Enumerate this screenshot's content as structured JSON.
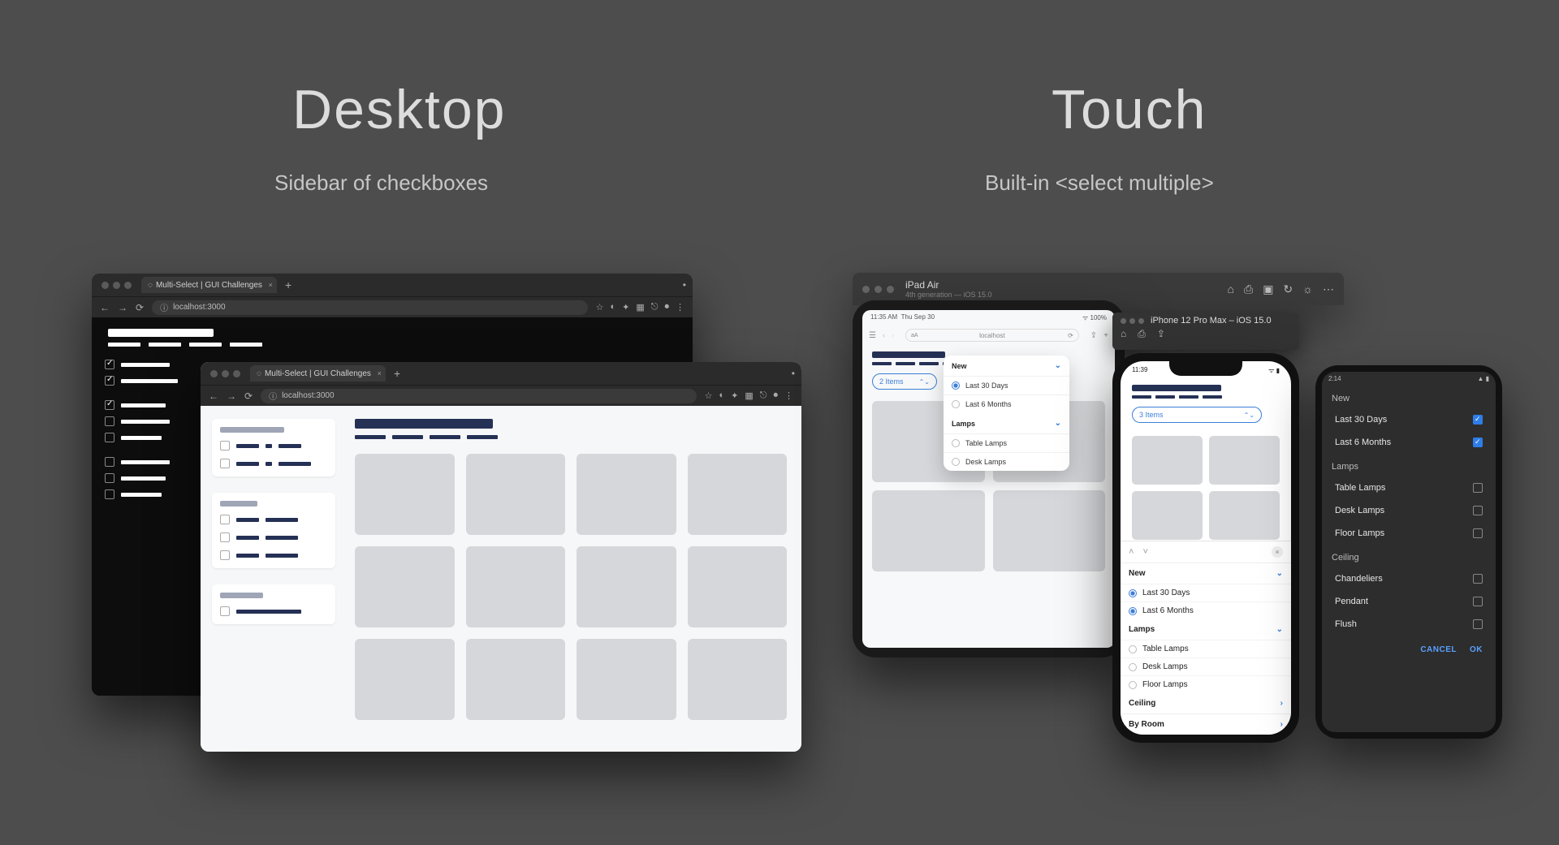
{
  "desktop": {
    "title": "Desktop",
    "subtitle": "Sidebar of checkboxes"
  },
  "touch": {
    "title": "Touch",
    "subtitle": "Built-in <select multiple>"
  },
  "browser": {
    "tab_title": "Multi-Select | GUI Challenges",
    "address": "localhost:3000"
  },
  "ipad_sim": {
    "device": "iPad Air",
    "detail": "4th generation — iOS 15.0"
  },
  "iphone_sim": {
    "device": "iPhone 12 Pro Max – iOS 15.0"
  },
  "ipad": {
    "status_time": "11:35 AM",
    "status_date": "Thu Sep 30",
    "url_host": "localhost",
    "pill_label": "2 Items",
    "popover": {
      "group1": "New",
      "options1": [
        "Last 30 Days",
        "Last 6 Months"
      ],
      "group2": "Lamps",
      "options2": [
        "Table Lamps",
        "Desk Lamps"
      ]
    }
  },
  "iphone": {
    "time": "11:39",
    "pill_label": "3 Items",
    "sheet": {
      "group1": "New",
      "options1": [
        "Last 30 Days",
        "Last 6 Months"
      ],
      "group2": "Lamps",
      "options2": [
        "Table Lamps",
        "Desk Lamps",
        "Floor Lamps"
      ],
      "group3": "Ceiling",
      "group4": "By Room"
    }
  },
  "android": {
    "time": "2:14",
    "group1": "New",
    "options1": [
      "Last 30 Days",
      "Last 6 Months"
    ],
    "selected1": [
      true,
      true
    ],
    "group2": "Lamps",
    "options2": [
      "Table Lamps",
      "Desk Lamps",
      "Floor Lamps"
    ],
    "selected2": [
      false,
      false,
      false
    ],
    "group3": "Ceiling",
    "options3": [
      "Chandeliers",
      "Pendant",
      "Flush"
    ],
    "selected3": [
      false,
      false,
      false
    ],
    "cancel": "CANCEL",
    "ok": "OK"
  }
}
